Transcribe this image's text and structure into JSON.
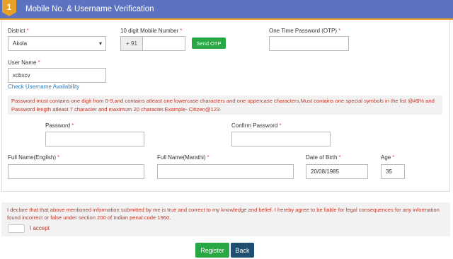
{
  "header": {
    "badge_number": "1",
    "title": "Mobile No. & Username Verification"
  },
  "form": {
    "district": {
      "label": "District",
      "required": "*",
      "value": "Akola"
    },
    "mobile": {
      "label": "10 digit Mobile Number",
      "required": "*",
      "prefix": "+ 91",
      "value": ""
    },
    "send_otp": "Send OTP",
    "otp": {
      "label": "One Time Password (OTP)",
      "required": "*",
      "value": ""
    },
    "username": {
      "label": "User Name",
      "required": "*",
      "value": "xcbxcv"
    },
    "check_username": "Check Username Availability",
    "password_rule": "Password must contains one digit from 0-9,and contains atleast one lowercase characters and one uppercase characters,Must contains one special symbols in the list @#$% and Password length atleast 7 character and maximum 20 character.Example- Citizen@123",
    "password": {
      "label": "Password",
      "required": "*",
      "value": ""
    },
    "confirm_password": {
      "label": "Confirm Password",
      "required": "*",
      "value": ""
    },
    "fullname_en": {
      "label": "Full Name(English)",
      "required": "*",
      "value": ""
    },
    "fullname_mr": {
      "label": "Full Name(Marathi)",
      "required": "*",
      "value": ""
    },
    "dob": {
      "label": "Date of Birth",
      "required": "*",
      "value": "20/08/1985"
    },
    "age": {
      "label": "Age",
      "required": "*",
      "value": "35"
    }
  },
  "declaration": {
    "text": "I declare that that above mentioned information submitted by me is true and correct to my knowledge and belief. I hereby agree to be liable for legal consequences for any information found incorrect or false under section 200 of Indian penal code 1960.",
    "accept_label": "I accept",
    "checked": false
  },
  "actions": {
    "register": "Register",
    "back": "Back"
  },
  "colors": {
    "header_bg": "#5b73c0",
    "accent": "#e7a126",
    "error_text": "#c0392b",
    "primary_green": "#28a745",
    "navy": "#1f4e6e",
    "link": "#337ab7"
  }
}
